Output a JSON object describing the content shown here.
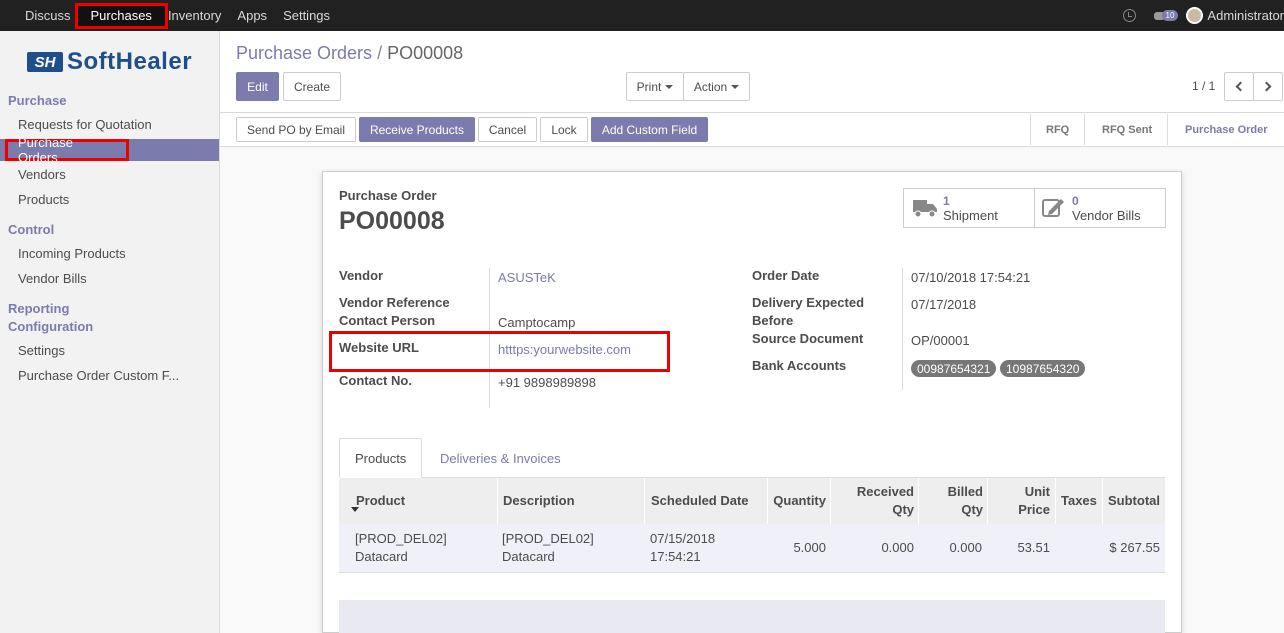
{
  "topnav": {
    "items": [
      "Discuss",
      "Purchases",
      "Inventory",
      "Apps",
      "Settings"
    ],
    "message_count": "10",
    "user": "Administrator"
  },
  "sidebar": {
    "logo_mark": "SH",
    "logo_text": "SoftHealer",
    "sections": [
      {
        "title": "Purchase",
        "items": [
          "Requests for Quotation",
          "Purchase Orders",
          "Vendors",
          "Products"
        ]
      },
      {
        "title": "Control",
        "items": [
          "Incoming Products",
          "Vendor Bills"
        ]
      },
      {
        "title": "Reporting",
        "items": []
      },
      {
        "title": "Configuration",
        "items": [
          "Settings",
          "Purchase Order Custom F..."
        ]
      }
    ]
  },
  "breadcrumb": {
    "parent": "Purchase Orders",
    "sep": "/",
    "current": "PO00008"
  },
  "buttons": {
    "edit": "Edit",
    "create": "Create",
    "print": "Print",
    "action": "Action"
  },
  "pager": "1 / 1",
  "header_buttons": [
    "Send PO by Email",
    "Receive Products",
    "Cancel",
    "Lock",
    "Add Custom Field"
  ],
  "stages": [
    "RFQ",
    "RFQ Sent",
    "Purchase Order"
  ],
  "form": {
    "doc_type": "Purchase Order",
    "name": "PO00008",
    "smart_buttons": [
      {
        "count": "1",
        "label": "Shipment"
      },
      {
        "count": "0",
        "label": "Vendor Bills"
      }
    ],
    "left": {
      "vendor_label": "Vendor",
      "vendor": "ASUSTeK",
      "vendor_ref_label": "Vendor Reference",
      "contact_label": "Contact Person",
      "contact": "Camptocamp",
      "website_label": "Website URL",
      "website": "htttps:yourwebsite.com",
      "phone_label": "Contact No.",
      "phone": "+91 9898989898"
    },
    "right": {
      "order_date_label": "Order Date",
      "order_date": "07/10/2018 17:54:21",
      "delivery_label_1": "Delivery Expected",
      "delivery_label_2": "Before",
      "delivery": "07/17/2018",
      "source_label": "Source Document",
      "source": "OP/00001",
      "bank_label": "Bank Accounts",
      "banks": [
        "00987654321",
        "10987654320"
      ]
    }
  },
  "tabs": [
    "Products",
    "Deliveries & Invoices"
  ],
  "table": {
    "headers": {
      "product": "Product",
      "description": "Description",
      "scheduled": "Scheduled Date",
      "quantity": "Quantity",
      "received_1": "Received",
      "received_2": "Qty",
      "billed_1": "Billed",
      "billed_2": "Qty",
      "price_1": "Unit",
      "price_2": "Price",
      "taxes": "Taxes",
      "subtotal": "Subtotal"
    },
    "row": {
      "product_1": "[PROD_DEL02]",
      "product_2": "Datacard",
      "desc_1": "[PROD_DEL02]",
      "desc_2": "Datacard",
      "date_1": "07/15/2018",
      "date_2": "17:54:21",
      "quantity": "5.000",
      "received": "0.000",
      "billed": "0.000",
      "price": "53.51",
      "taxes": "",
      "subtotal": "$ 267.55"
    }
  }
}
